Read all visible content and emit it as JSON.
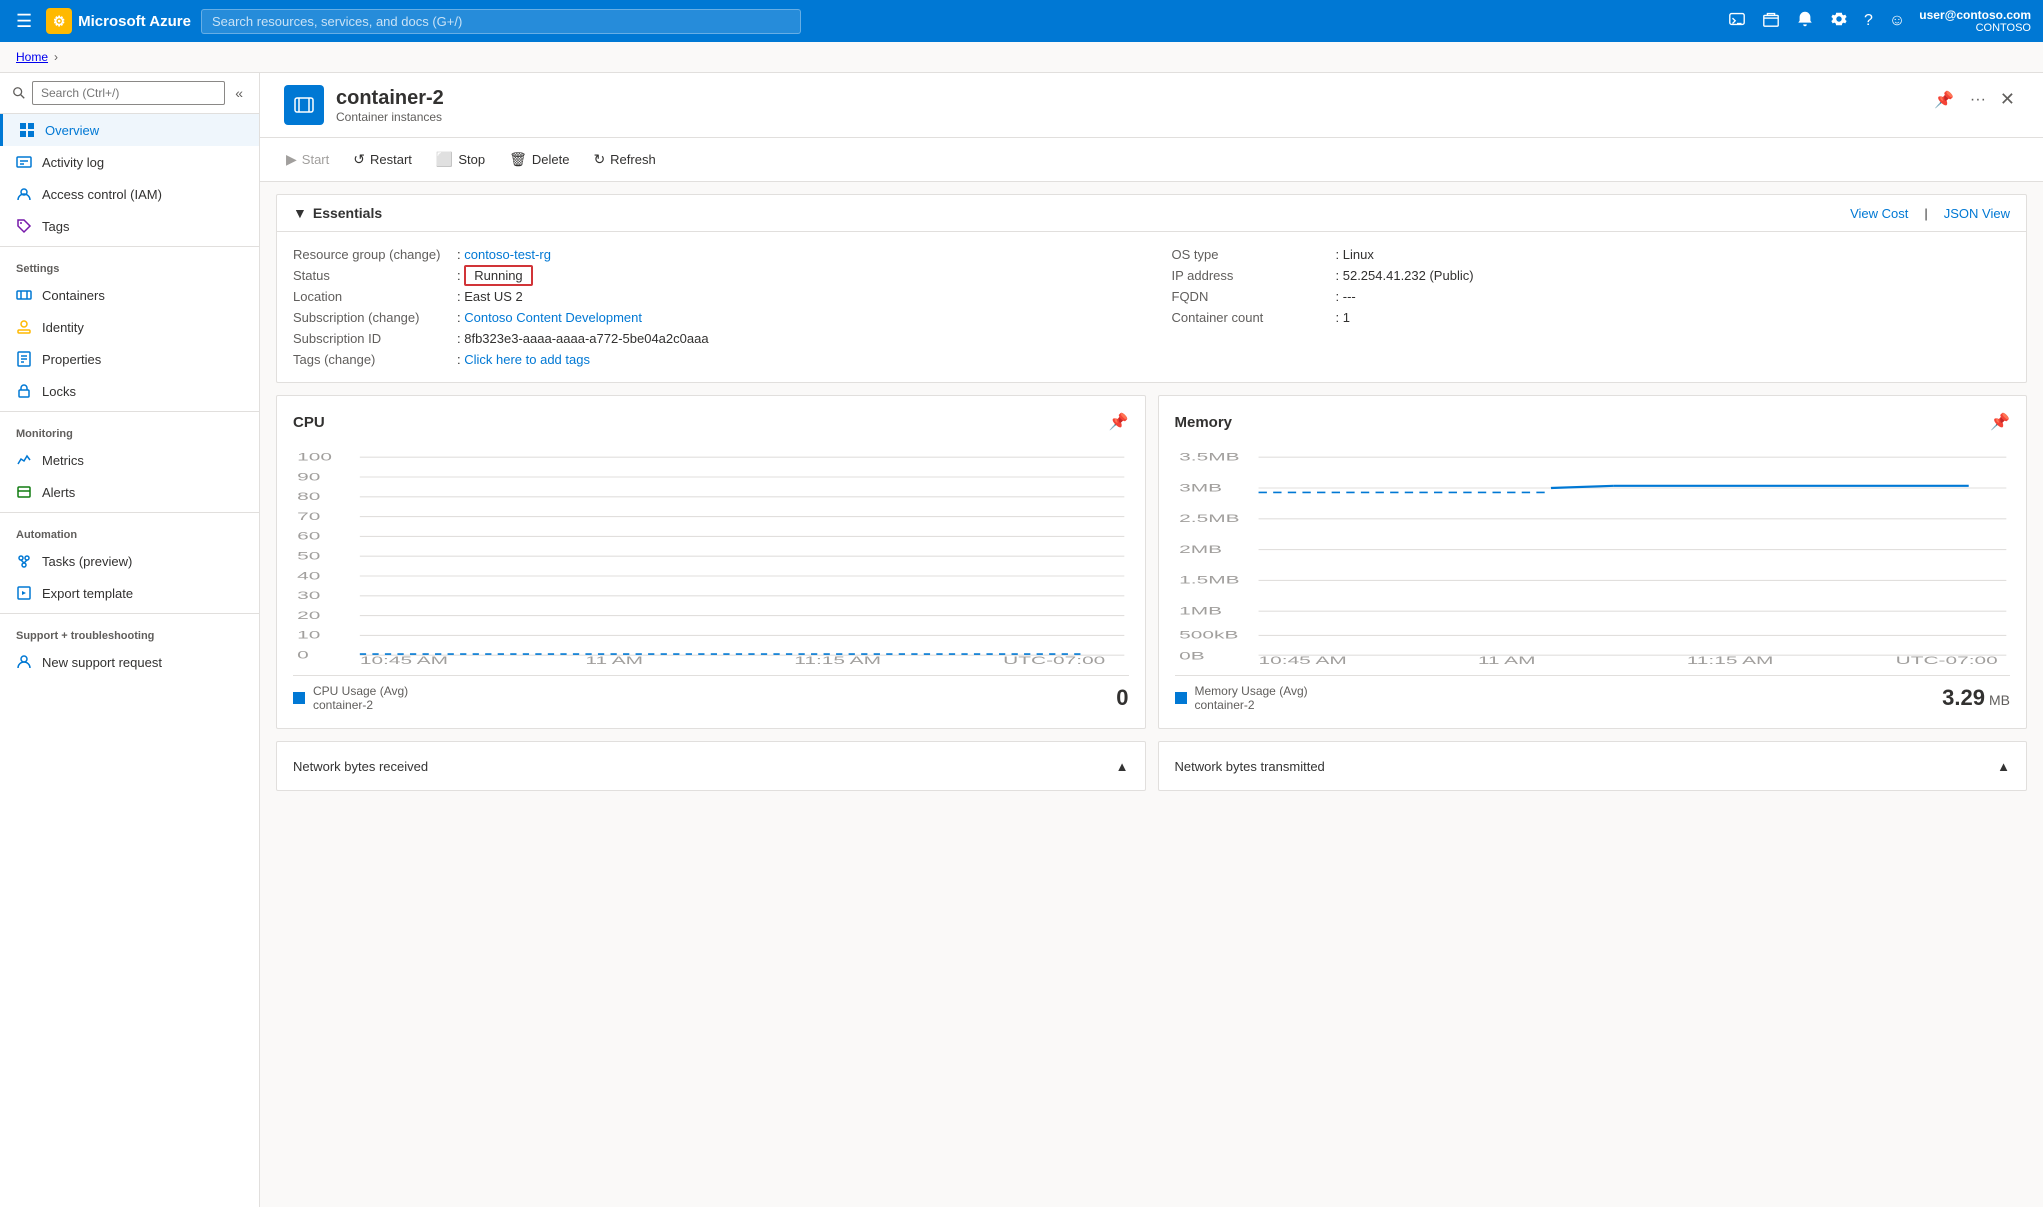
{
  "topnav": {
    "app_name": "Microsoft Azure",
    "search_placeholder": "Search resources, services, and docs (G+/)",
    "user_name": "user@contoso.com",
    "user_org": "CONTOSO"
  },
  "breadcrumb": {
    "home": "Home"
  },
  "page_header": {
    "title": "container-2",
    "subtitle": "Container instances"
  },
  "toolbar": {
    "start_label": "Start",
    "restart_label": "Restart",
    "stop_label": "Stop",
    "delete_label": "Delete",
    "refresh_label": "Refresh"
  },
  "essentials": {
    "title": "Essentials",
    "view_cost_label": "View Cost",
    "json_view_label": "JSON View",
    "fields": {
      "resource_group_label": "Resource group (change)",
      "resource_group_value": "contoso-test-rg",
      "status_label": "Status",
      "status_value": "Running",
      "location_label": "Location",
      "location_value": "East US 2",
      "subscription_label": "Subscription (change)",
      "subscription_value": "Contoso Content Development",
      "subscription_id_label": "Subscription ID",
      "subscription_id_value": "8fb323e3-aaaa-aaaa-a772-5be04a2c0aaa",
      "tags_label": "Tags (change)",
      "tags_value": "Click here to add tags",
      "os_type_label": "OS type",
      "os_type_value": "Linux",
      "ip_address_label": "IP address",
      "ip_address_value": "52.254.41.232 (Public)",
      "fqdn_label": "FQDN",
      "fqdn_value": "---",
      "container_count_label": "Container count",
      "container_count_value": "1"
    }
  },
  "sidebar": {
    "search_placeholder": "Search (Ctrl+/)",
    "items": {
      "overview": "Overview",
      "activity_log": "Activity log",
      "access_control": "Access control (IAM)",
      "tags": "Tags",
      "settings_header": "Settings",
      "containers": "Containers",
      "identity": "Identity",
      "properties": "Properties",
      "locks": "Locks",
      "monitoring_header": "Monitoring",
      "metrics": "Metrics",
      "alerts": "Alerts",
      "automation_header": "Automation",
      "tasks_preview": "Tasks (preview)",
      "export_template": "Export template",
      "support_header": "Support + troubleshooting",
      "new_support_request": "New support request"
    }
  },
  "charts": {
    "cpu": {
      "title": "CPU",
      "y_labels": [
        "100",
        "90",
        "80",
        "70",
        "60",
        "50",
        "40",
        "30",
        "20",
        "10",
        "0"
      ],
      "x_labels": [
        "10:45 AM",
        "11 AM",
        "11:15 AM",
        "UTC-07:00"
      ],
      "legend_label": "CPU Usage (Avg)",
      "legend_sublabel": "container-2",
      "legend_value": "0"
    },
    "memory": {
      "title": "Memory",
      "y_labels": [
        "3.5MB",
        "3MB",
        "2.5MB",
        "2MB",
        "1.5MB",
        "1MB",
        "500kB",
        "0B"
      ],
      "x_labels": [
        "10:45 AM",
        "11 AM",
        "11:15 AM",
        "UTC-07:00"
      ],
      "legend_label": "Memory Usage (Avg)",
      "legend_sublabel": "container-2",
      "legend_value": "3.29",
      "legend_unit": "MB"
    }
  }
}
